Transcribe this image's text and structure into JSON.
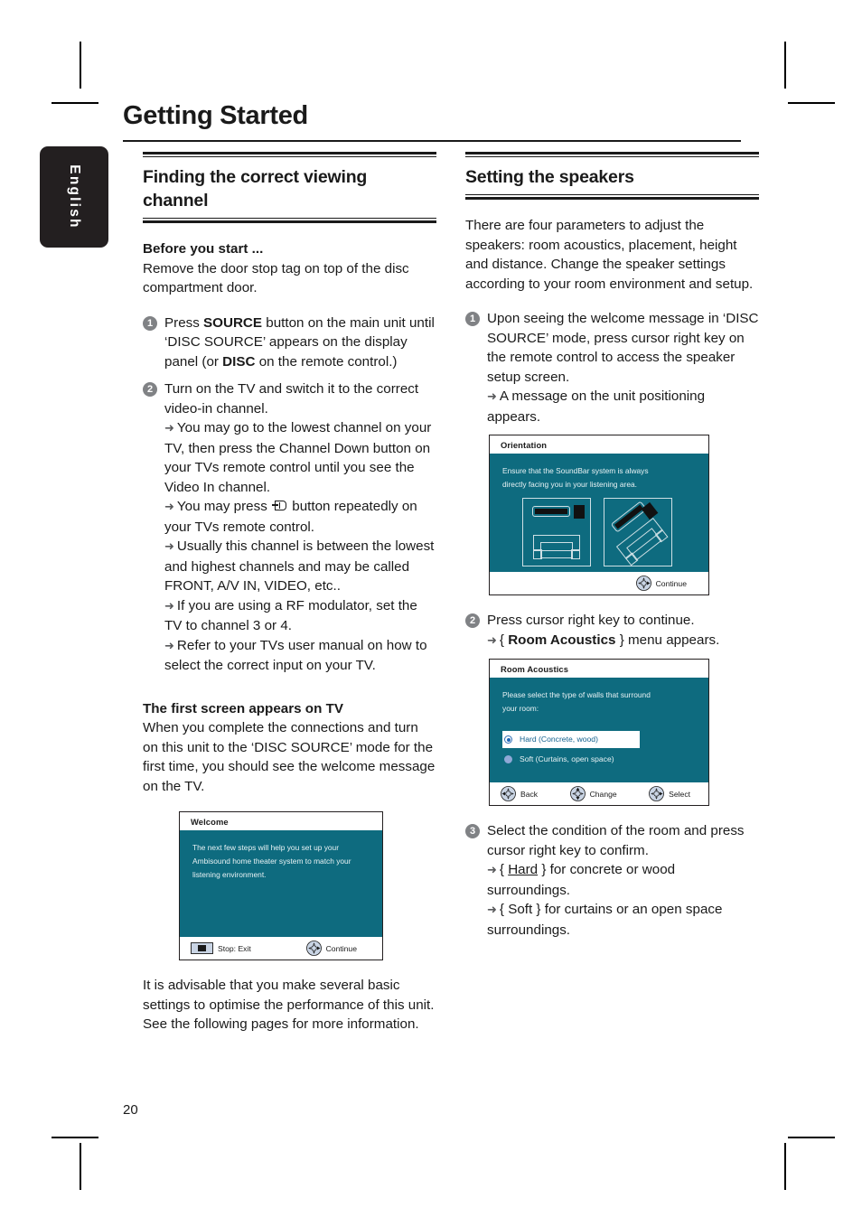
{
  "page": {
    "title": "Getting Started",
    "number": "20",
    "language_tab": "English"
  },
  "left_column": {
    "section_heading": "Finding the correct viewing channel",
    "before_you_start": {
      "heading": "Before you start ...",
      "text": "Remove the door stop tag on top of the disc compartment door."
    },
    "steps": [
      {
        "num": "1",
        "text_parts": [
          "Press ",
          "SOURCE",
          " button on the main unit until ‘DISC SOURCE’ appears on the display panel (or ",
          "DISC",
          " on the remote control.)"
        ]
      },
      {
        "num": "2",
        "text": "Turn on the TV and switch it to the correct video-in channel.",
        "bullets": [
          "You may go to the lowest channel on your TV, then press the Channel Down button on your TVs remote control until you see the Video In channel.",
          "You may press ⌘ button repeatedly on your TVs remote control.",
          "Usually this channel is between the lowest and highest channels and may be called FRONT, A/V IN, VIDEO, etc..",
          "If you are using a RF modulator, set the TV to channel 3 or 4.",
          "Refer to your TVs user manual on how to select the correct input on your TV."
        ],
        "bullet2_pre": "You may press ",
        "bullet2_post": " button repeatedly on your TVs remote control."
      }
    ],
    "first_screen": {
      "heading": "The first screen appears on TV",
      "text": "When you complete the connections and turn on this unit to the ‘DISC SOURCE’ mode for the first time, you should see the welcome message on the TV."
    },
    "closing_text": "It is advisable that you make several basic settings to optimise the performance of this unit.  See the following pages for more information.",
    "welcome_screen": {
      "title": "Welcome",
      "body_lines": [
        "The next few steps will help you set up your",
        "Ambisound home theater system to match your",
        "listening environment."
      ],
      "footer": {
        "left_icon": "stop-icon",
        "left_label": "Stop: Exit",
        "right_icon": "dpad-right-icon",
        "right_label": "Continue"
      }
    }
  },
  "right_column": {
    "section_heading": "Setting the speakers",
    "intro": "There are four parameters to adjust the speakers: room acoustics, placement, height and distance.  Change the speaker settings according to your room environment and setup.",
    "steps": [
      {
        "num": "1",
        "text": "Upon seeing the welcome message in ‘DISC SOURCE’ mode, press cursor right key on the remote control to access the speaker setup screen.",
        "bullet": "A message on the unit positioning appears."
      },
      {
        "num": "2",
        "text": "Press cursor right key to continue.",
        "bullet_pre": "{ ",
        "bullet_strong": "Room Acoustics",
        "bullet_post": " } menu appears."
      },
      {
        "num": "3",
        "text": "Select the condition of the room and press cursor right key to confirm.",
        "bullet_hard_pre": "{ ",
        "bullet_hard_word": "Hard",
        "bullet_hard_post": " } for concrete or wood surroundings.",
        "bullet_soft": "{ Soft } for curtains or an open space surroundings."
      }
    ],
    "orientation_screen": {
      "title": "Orientation",
      "body_lines": [
        "Ensure that the SoundBar system is always",
        "directly facing you in your listening area."
      ],
      "footer": {
        "icon": "dpad-right-icon",
        "label": "Continue"
      }
    },
    "room_acoustics_screen": {
      "title": "Room Acoustics",
      "body_lines": [
        "Please select the type of walls that surround",
        "your room:"
      ],
      "options": [
        {
          "label": "Hard (Concrete, wood)",
          "selected": true
        },
        {
          "label": "Soft (Curtains, open space)",
          "selected": false
        }
      ],
      "footer": [
        {
          "icon": "dpad-left-icon",
          "label": "Back"
        },
        {
          "icon": "dpad-updown-icon",
          "label": "Change"
        },
        {
          "icon": "dpad-right-icon",
          "label": "Select"
        }
      ]
    }
  },
  "colors": {
    "screen_teal": "#0e6b7f",
    "step_badge": "#808285",
    "selected_text": "#14628f",
    "tab_black": "#231f20"
  }
}
